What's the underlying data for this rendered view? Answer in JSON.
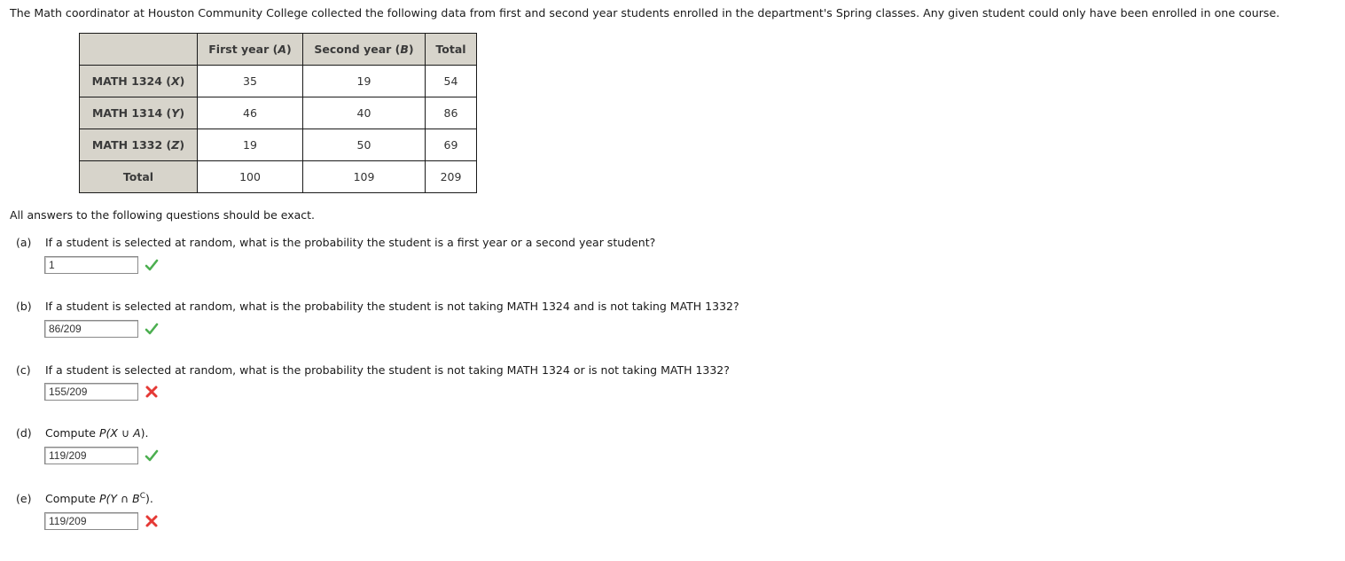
{
  "intro": "The Math coordinator at Houston Community College collected the following data from first and second year students enrolled in the department's Spring classes. Any given student could only have been enrolled in one course.",
  "table": {
    "headers": [
      {
        "text": "",
        "var": ""
      },
      {
        "text": "First year (",
        "var": "A",
        "close": ")"
      },
      {
        "text": "Second year (",
        "var": "B",
        "close": ")"
      },
      {
        "text": "Total",
        "var": "",
        "close": ""
      }
    ],
    "rows": [
      {
        "label": "MATH 1324 (",
        "var": "X",
        "close": ")",
        "values": [
          "35",
          "19",
          "54"
        ]
      },
      {
        "label": "MATH 1314 (",
        "var": "Y",
        "close": ")",
        "values": [
          "46",
          "40",
          "86"
        ]
      },
      {
        "label": "MATH 1332 (",
        "var": "Z",
        "close": ")",
        "values": [
          "19",
          "50",
          "69"
        ]
      },
      {
        "label": "Total",
        "var": "",
        "close": "",
        "values": [
          "100",
          "109",
          "209"
        ]
      }
    ]
  },
  "note": "All answers to the following questions should be exact.",
  "questions": [
    {
      "label": "(a)",
      "text": "If a student is selected at random, what is the probability the student is a first year or a second year student?",
      "answer": "1",
      "status": "correct"
    },
    {
      "label": "(b)",
      "text": "If a student is selected at random, what is the probability the student is not taking MATH 1324 and is not taking MATH 1332?",
      "answer": "86/209",
      "status": "correct"
    },
    {
      "label": "(c)",
      "text": "If a student is selected at random, what is the probability the student is not taking MATH 1324 or is not taking MATH 1332?",
      "answer": "155/209",
      "status": "incorrect"
    },
    {
      "label": "(d)",
      "text_pre": "Compute ",
      "expr_d": "P(",
      "expr_d_x": "X",
      "expr_d_op": " ∪ ",
      "expr_d_a": "A",
      "expr_d_end": ").",
      "answer": "119/209",
      "status": "correct"
    },
    {
      "label": "(e)",
      "text_pre": "Compute ",
      "expr_e": "P(",
      "expr_e_y": "Y",
      "expr_e_op": " ∩ ",
      "expr_e_b": "B",
      "expr_e_sup": "C",
      "expr_e_end": ").",
      "answer": "119/209",
      "status": "incorrect"
    }
  ],
  "colors": {
    "correct": "#4caf50",
    "incorrect": "#e53935",
    "header_bg": "#d7d4cb"
  }
}
